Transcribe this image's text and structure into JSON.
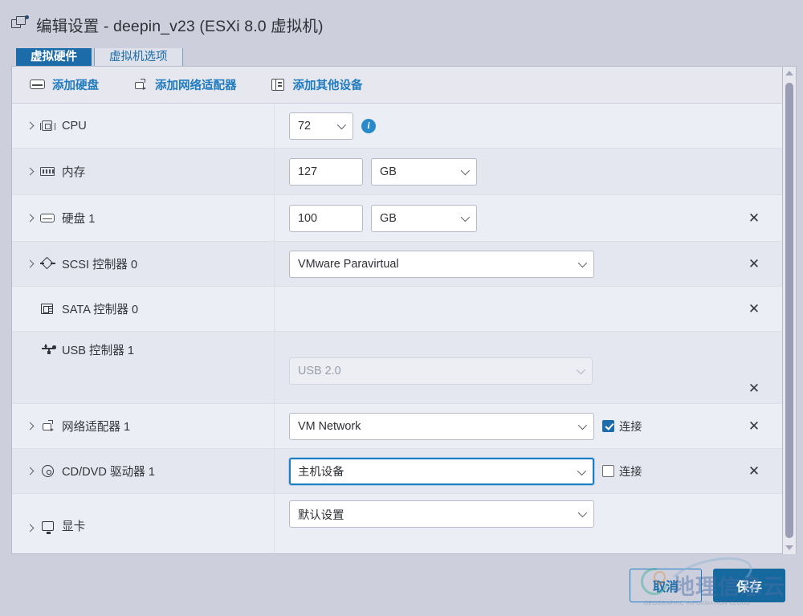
{
  "dialog": {
    "title": "编辑设置 - deepin_v23 (ESXi 8.0 虚拟机)",
    "icon": "virtual-machine-icon"
  },
  "tabs": [
    {
      "label": "虚拟硬件",
      "active": true
    },
    {
      "label": "虚拟机选项",
      "active": false
    }
  ],
  "toolbar": {
    "actions": [
      {
        "label": "添加硬盘",
        "icon": "hard-disk-icon"
      },
      {
        "label": "添加网络适配器",
        "icon": "network-adapter-icon"
      },
      {
        "label": "添加其他设备",
        "icon": "other-device-icon"
      }
    ]
  },
  "devices": [
    {
      "name": "CPU",
      "icon": "cpu-icon",
      "expandable": true,
      "control": "select",
      "value": "72",
      "info_icon": "info-icon",
      "removable": false
    },
    {
      "name": "内存",
      "icon": "memory-icon",
      "expandable": true,
      "control": "text-unit",
      "value": "127",
      "unit": "GB",
      "removable": false
    },
    {
      "name": "硬盘 1",
      "icon": "hard-disk-icon",
      "expandable": true,
      "control": "text-unit",
      "value": "100",
      "unit": "GB",
      "removable": true,
      "remove_label": "✕"
    },
    {
      "name": "SCSI 控制器 0",
      "icon": "scsi-controller-icon",
      "expandable": true,
      "control": "select",
      "value": "VMware Paravirtual",
      "removable": true,
      "remove_label": "✕"
    },
    {
      "name": "SATA 控制器 0",
      "icon": "sata-controller-icon",
      "expandable": false,
      "control": "none",
      "value": "",
      "removable": true,
      "remove_label": "✕"
    },
    {
      "name": "USB 控制器 1",
      "icon": "usb-controller-icon",
      "expandable": false,
      "control": "select-disabled",
      "value": "USB 2.0",
      "removable": true,
      "remove_label": "✕"
    },
    {
      "name": "网络适配器 1",
      "icon": "network-adapter-icon",
      "expandable": true,
      "control": "select",
      "value": "VM Network",
      "checkbox_label": "连接",
      "checked": true,
      "removable": true,
      "remove_label": "✕"
    },
    {
      "name": "CD/DVD 驱动器 1",
      "icon": "cd-dvd-icon",
      "expandable": true,
      "control": "select",
      "value": "主机设备",
      "focused": true,
      "checkbox_label": "连接",
      "checked": false,
      "removable": true,
      "remove_label": "✕"
    },
    {
      "name": "显卡",
      "icon": "graphics-card-icon",
      "expandable": true,
      "control": "select",
      "value": "默认设置",
      "removable": false
    }
  ],
  "scrollbar": {
    "up_arrow": "scroll-up-arrow",
    "down_arrow": "scroll-down-arrow"
  },
  "footer": {
    "cancel_label": "取消",
    "save_label": "保存"
  },
  "watermark": {
    "text": "地理信息云",
    "subtext": "GEOGRAPHIC INFORMATION CLOUD"
  },
  "colors": {
    "accent": "#1b6ca8",
    "link": "#1f7bbf",
    "primary_button": "#16699e",
    "focus_border": "#1b7ec4"
  }
}
